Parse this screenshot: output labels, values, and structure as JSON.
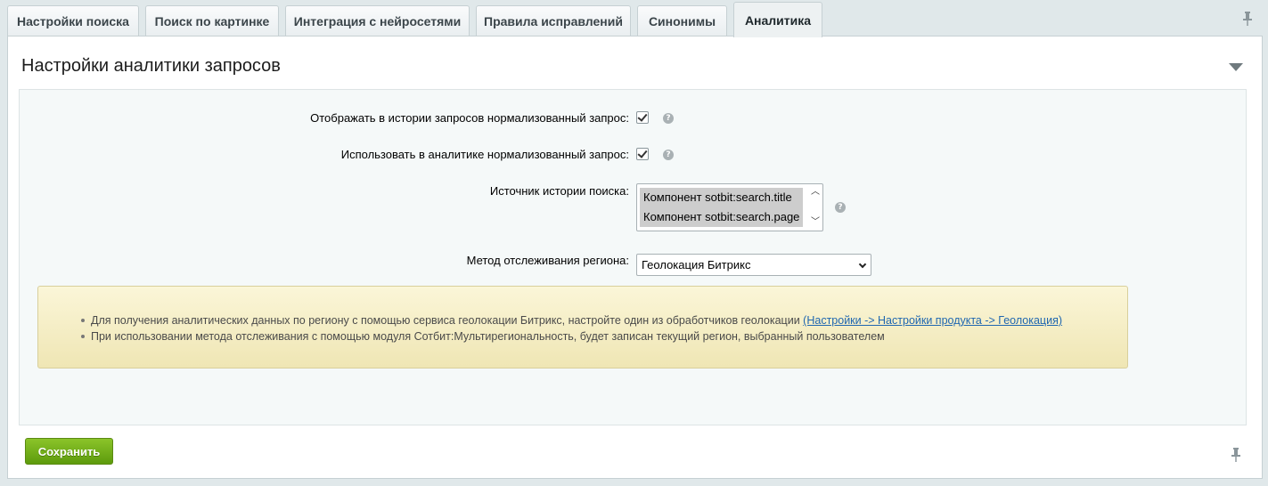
{
  "tabs": [
    {
      "label": "Настройки поиска"
    },
    {
      "label": "Поиск по картинке"
    },
    {
      "label": "Интеграция с нейросетями"
    },
    {
      "label": "Правила исправлений"
    },
    {
      "label": "Синонимы"
    },
    {
      "label": "Аналитика",
      "active": true
    }
  ],
  "panel": {
    "title": "Настройки аналитики запросов"
  },
  "fields": {
    "history_normalized_label": "Отображать в истории запросов нормализованный запрос:",
    "analytics_normalized_label": "Использовать в аналитике нормализованный запрос:",
    "source_label": "Источник истории поиска:",
    "source_options": [
      "Компонент sotbit:search.title",
      "Компонент sotbit:search.page"
    ],
    "region_label": "Метод отслеживания региона:",
    "region_value": "Геолокация Битрикс",
    "help": "?"
  },
  "notice": {
    "line1": "Для получения аналитических данных по региону с помощью сервиса геолокации Битрикс, настройте один из обработчиков геолокации",
    "line1_link": "(Настройки -> Настройки продукта -> Геолокация)",
    "line2": "При использовании метода отслеживания с помощью модуля Сотбит:Мультирегиональность, будет записан текущий регион, выбранный пользователем"
  },
  "footer": {
    "save_label": "Сохранить"
  },
  "colors": {
    "save_button": "#6fab14",
    "link": "#2067b0",
    "notice_bg": "#f4edc4"
  }
}
